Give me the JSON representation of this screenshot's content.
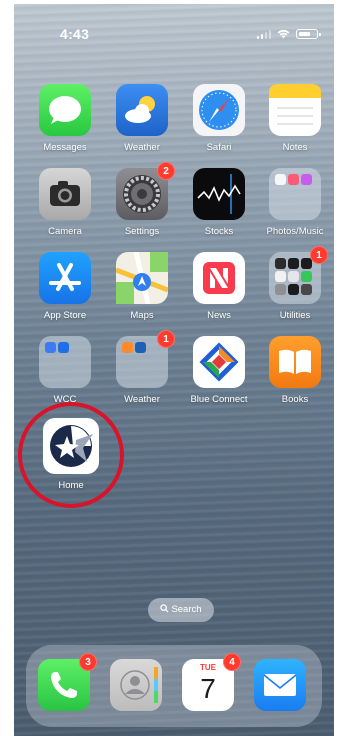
{
  "status_bar": {
    "time": "4:43",
    "icons": [
      "signal-icon",
      "wifi-icon",
      "battery-icon"
    ]
  },
  "home_screen": {
    "apps": [
      {
        "label": "Messages",
        "icon": "messages-icon"
      },
      {
        "label": "Weather",
        "icon": "weather-icon"
      },
      {
        "label": "Safari",
        "icon": "safari-icon"
      },
      {
        "label": "Notes",
        "icon": "notes-icon"
      },
      {
        "label": "Camera",
        "icon": "camera-icon"
      },
      {
        "label": "Settings",
        "icon": "gear-icon",
        "badge": "2"
      },
      {
        "label": "Stocks",
        "icon": "stocks-icon"
      },
      {
        "label": "Photos/Music",
        "icon": "folder-icon"
      },
      {
        "label": "App Store",
        "icon": "app-store-icon"
      },
      {
        "label": "Maps",
        "icon": "maps-icon"
      },
      {
        "label": "News",
        "icon": "news-icon"
      },
      {
        "label": "Utilities",
        "icon": "folder-icon",
        "badge": "1"
      },
      {
        "label": "WCC",
        "icon": "folder-icon"
      },
      {
        "label": "Weather",
        "icon": "folder-icon",
        "badge": "1"
      },
      {
        "label": "Blue Connect",
        "icon": "blue-connect-icon"
      },
      {
        "label": "Books",
        "icon": "books-icon"
      },
      {
        "label": "Home",
        "icon": "home-app-icon",
        "highlighted": true
      }
    ]
  },
  "search": {
    "label": "Search",
    "icon": "search-icon"
  },
  "dock": {
    "apps": [
      {
        "label": "Phone",
        "icon": "phone-icon",
        "badge": "3"
      },
      {
        "label": "Contacts",
        "icon": "contacts-icon"
      },
      {
        "label": "Calendar",
        "icon": "calendar-icon",
        "badge": "4",
        "day": "TUE",
        "date": "7"
      },
      {
        "label": "Mail",
        "icon": "mail-icon"
      }
    ]
  },
  "colors": {
    "badge": "#ff3b30",
    "highlight_ring": "#d7142a"
  }
}
